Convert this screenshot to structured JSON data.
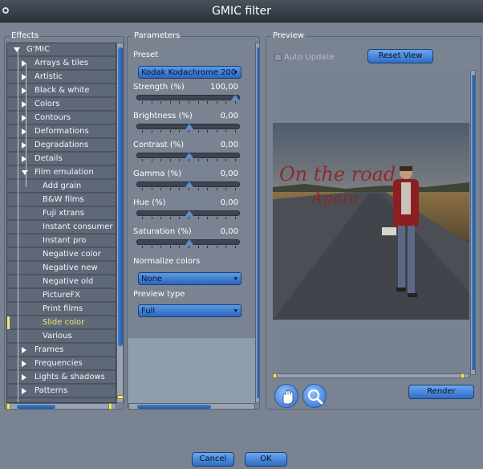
{
  "window": {
    "title": "GMIC filter"
  },
  "effects": {
    "title": "Effects",
    "root": "G'MIC",
    "categories_top": [
      "Arrays & tiles",
      "Artistic",
      "Black & white",
      "Colors",
      "Contours",
      "Deformations",
      "Degradations",
      "Details",
      "Film emulation"
    ],
    "film_children": [
      "Add grain",
      "B&W films",
      "Fuji xtrans",
      "Instant consumer",
      "Instant pro",
      "Negative color",
      "Negative new",
      "Negative old",
      "PictureFX",
      "Print films",
      "Slide color",
      "Various"
    ],
    "selected": "Slide color",
    "categories_bottom": [
      "Frames",
      "Frequencies",
      "Lights & shadows",
      "Patterns"
    ]
  },
  "parameters": {
    "title": "Parameters",
    "preset_label": "Preset",
    "preset_value": "Kodak Kodachrome 200",
    "sliders": [
      {
        "label": "Strength (%)",
        "value": "100,00",
        "level": 1.0
      },
      {
        "label": "Brightness (%)",
        "value": "0,00",
        "level": 0.5
      },
      {
        "label": "Contrast (%)",
        "value": "0,00",
        "level": 0.5
      },
      {
        "label": "Gamma (%)",
        "value": "0,00",
        "level": 0.5
      },
      {
        "label": "Hue (%)",
        "value": "0,00",
        "level": 0.5
      },
      {
        "label": "Saturation (%)",
        "value": "0,00",
        "level": 0.5
      }
    ],
    "normalize_label": "Normalize colors",
    "normalize_value": "None",
    "preview_type_label": "Preview type",
    "preview_type_value": "Full"
  },
  "preview": {
    "title": "Preview",
    "auto_update_label": "Auto Update",
    "auto_update_checked": false,
    "reset_view_label": "Reset View",
    "render_label": "Render",
    "tools": [
      "hand-icon",
      "magnifier-icon"
    ]
  },
  "footer": {
    "cancel_label": "Cancel",
    "ok_label": "OK"
  },
  "colors": {
    "accent": "#2f6cc4",
    "selection": "#f1e97a",
    "panel": "#7a8391"
  }
}
